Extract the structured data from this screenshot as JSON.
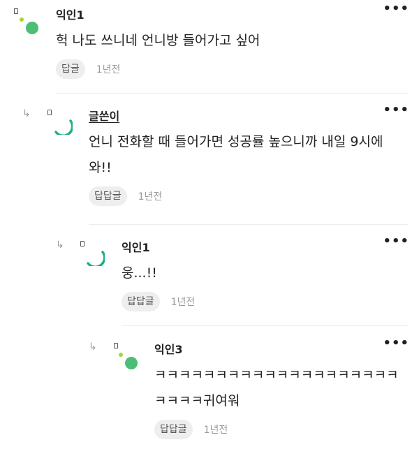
{
  "comments": [
    {
      "author": "익인1",
      "text": "헉 나도 쓰니네 언니방 들어가고 싶어",
      "reply_label": "답글",
      "time": "1년전",
      "more": "•••"
    },
    {
      "author": "글쓴이",
      "text": "언니 전화할 때 들어가면 성공률 높으니까 내일 9시에 와!!",
      "reply_label": "답답글",
      "time": "1년전",
      "more": "•••"
    },
    {
      "author": "익인1",
      "text": "웅...!!",
      "reply_label": "답답글",
      "time": "1년전",
      "more": "•••"
    },
    {
      "author": "익인3",
      "text": "ㅋㅋㅋㅋㅋㅋㅋㅋㅋㅋㅋㅋㅋㅋㅋㅋㅋㅋㅋㅋㅋㅋㅋㅋ귀여워",
      "reply_label": "답답글",
      "time": "1년전",
      "more": "•••"
    }
  ],
  "icons": {
    "reply_arrow": "↳",
    "avatar_green": "#4cbe76",
    "avatar_lime": "#a8d43a",
    "avatar_teal": "#1fb07a"
  }
}
